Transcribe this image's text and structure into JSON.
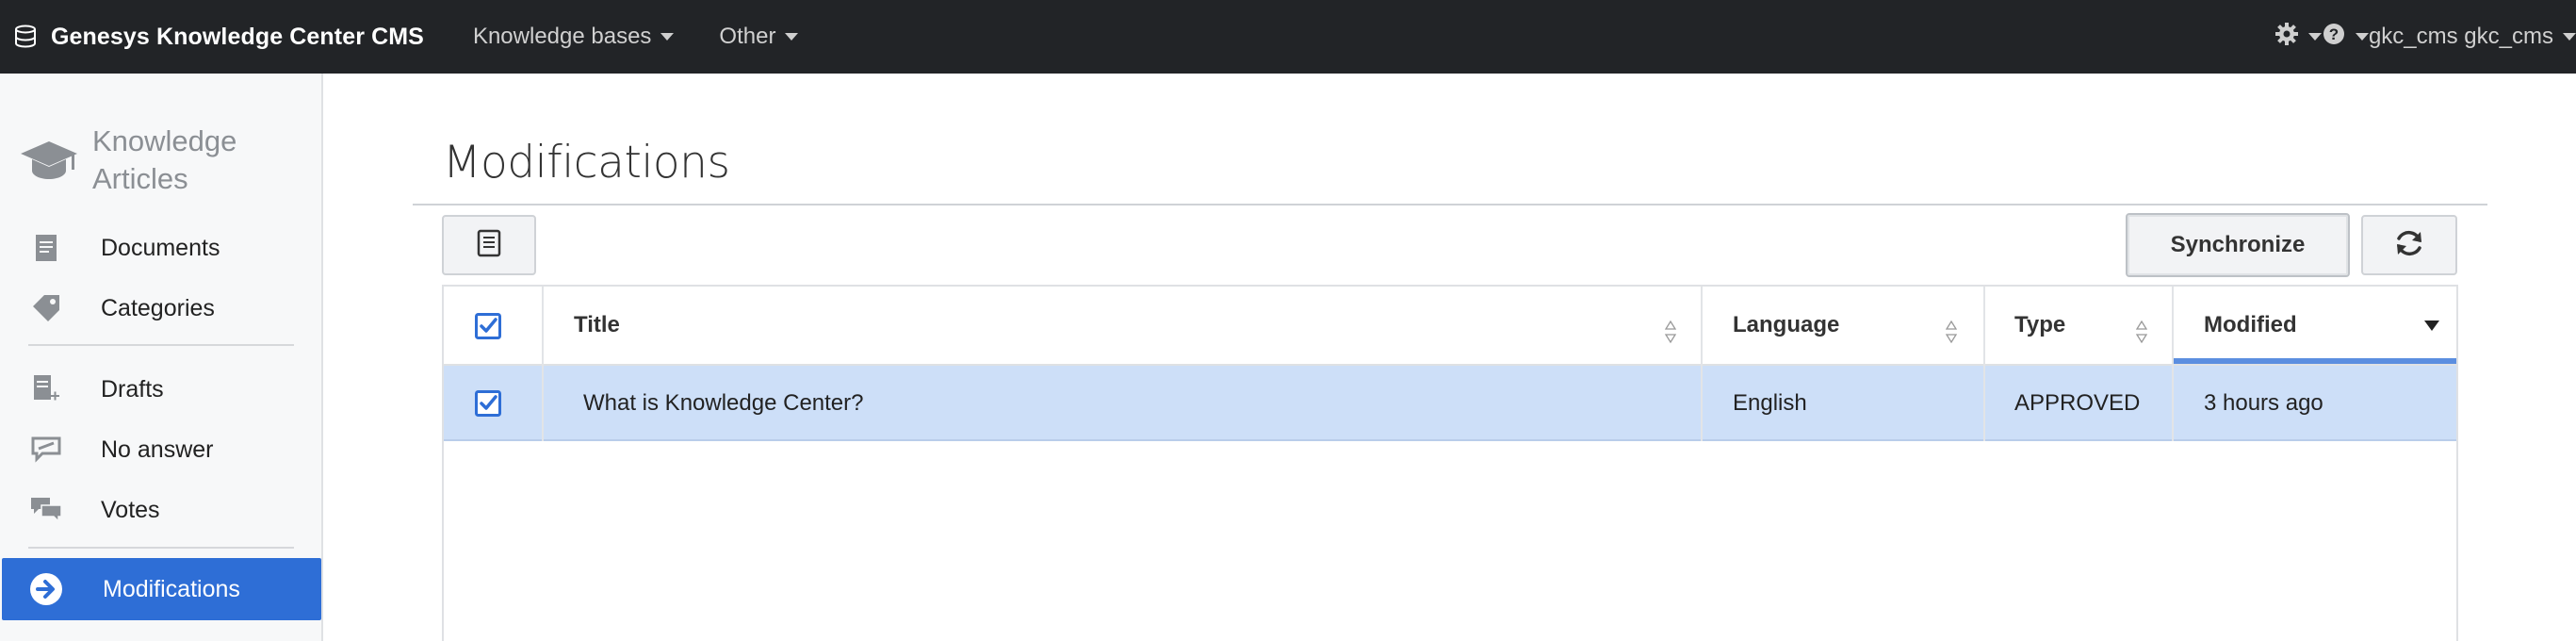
{
  "navbar": {
    "brand": "Genesys Knowledge Center CMS",
    "menu": [
      {
        "label": "Knowledge bases"
      },
      {
        "label": "Other"
      }
    ],
    "settings_icon": "gear-icon",
    "help_icon": "question-circle-icon",
    "user": "gkc_cms gkc_cms"
  },
  "sidebar": {
    "heading": "Knowledge Articles",
    "heading_icon": "graduation-cap-icon",
    "items": [
      {
        "label": "Documents",
        "icon": "document-icon"
      },
      {
        "label": "Categories",
        "icon": "tag-icon"
      },
      {
        "label": "Drafts",
        "icon": "draft-plus-icon"
      },
      {
        "label": "No answer",
        "icon": "no-answer-bubble-icon"
      },
      {
        "label": "Votes",
        "icon": "chat-bubbles-icon"
      },
      {
        "label": "Modifications",
        "icon": "arrow-right-circle-icon",
        "active": true
      }
    ]
  },
  "main": {
    "title": "Modifications",
    "toolbar": {
      "doc_button_icon": "document-list-icon",
      "sync_label": "Synchronize",
      "refresh_icon": "refresh-icon"
    },
    "table": {
      "columns": [
        "Title",
        "Language",
        "Type",
        "Modified"
      ],
      "sorted_column": "Modified",
      "sort_direction": "desc",
      "rows": [
        {
          "checked": true,
          "title": "What is Knowledge Center?",
          "language": "English",
          "type": "APPROVED",
          "modified": "3 hours ago",
          "selected": true
        }
      ],
      "header_checked": true
    }
  },
  "colors": {
    "navbar_bg": "#222427",
    "accent": "#2e6ed6",
    "selected_row": "#cddff8",
    "sidebar_bg": "#f7f8f9"
  }
}
